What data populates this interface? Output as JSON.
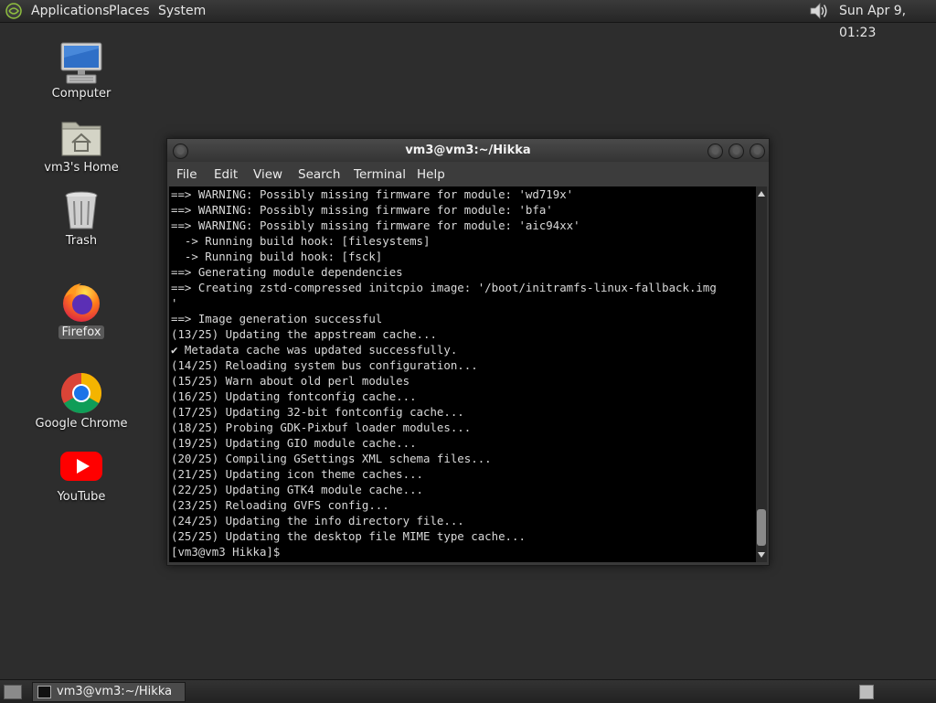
{
  "top_panel": {
    "menus": [
      "Applications",
      "Places",
      "System"
    ],
    "clock": "Sun Apr  9, 01:23",
    "logo_icon": "distro-logo-icon",
    "volume_icon": "volume-icon"
  },
  "desktop": {
    "icons": [
      {
        "label": "Computer",
        "icon": "computer-icon"
      },
      {
        "label": "vm3's Home",
        "icon": "home-folder-icon"
      },
      {
        "label": "Trash",
        "icon": "trash-icon"
      },
      {
        "label": "Firefox",
        "icon": "firefox-icon"
      },
      {
        "label": "Google Chrome",
        "icon": "chrome-icon"
      },
      {
        "label": "YouTube",
        "icon": "youtube-icon"
      }
    ]
  },
  "terminal": {
    "title": "vm3@vm3:~/Hikka",
    "menu": [
      "File",
      "Edit",
      "View",
      "Search",
      "Terminal",
      "Help"
    ],
    "lines": [
      "==> WARNING: Possibly missing firmware for module: 'wd719x'",
      "==> WARNING: Possibly missing firmware for module: 'bfa'",
      "==> WARNING: Possibly missing firmware for module: 'aic94xx'",
      "  -> Running build hook: [filesystems]",
      "  -> Running build hook: [fsck]",
      "==> Generating module dependencies",
      "==> Creating zstd-compressed initcpio image: '/boot/initramfs-linux-fallback.img",
      "'",
      "==> Image generation successful",
      "(13/25) Updating the appstream cache...",
      "✔ Metadata cache was updated successfully.",
      "(14/25) Reloading system bus configuration...",
      "(15/25) Warn about old perl modules",
      "(16/25) Updating fontconfig cache...",
      "(17/25) Updating 32-bit fontconfig cache...",
      "(18/25) Probing GDK-Pixbuf loader modules...",
      "(19/25) Updating GIO module cache...",
      "(20/25) Compiling GSettings XML schema files...",
      "(21/25) Updating icon theme caches...",
      "(22/25) Updating GTK4 module cache...",
      "(23/25) Reloading GVFS config...",
      "(24/25) Updating the info directory file...",
      "(25/25) Updating the desktop file MIME type cache...",
      "[vm3@vm3 Hikka]$ "
    ]
  },
  "taskbar": {
    "tasks": [
      {
        "label": "vm3@vm3:~/Hikka",
        "icon": "terminal-icon"
      }
    ],
    "show_desktop_icon": "show-desktop-icon",
    "workspace_icon": "workspace-switcher-icon"
  }
}
